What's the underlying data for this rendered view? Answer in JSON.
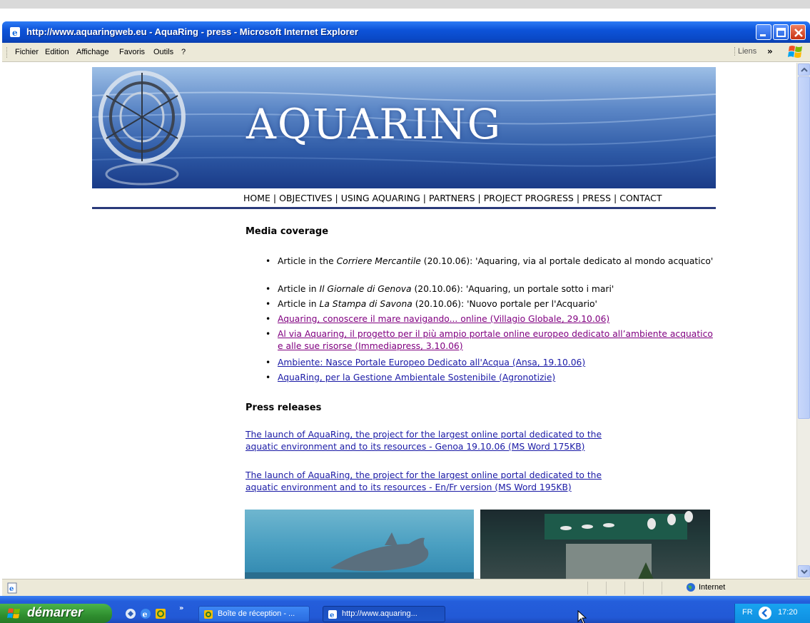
{
  "window": {
    "title": "http://www.aquaringweb.eu - AquaRing - press - Microsoft Internet Explorer"
  },
  "menubar": {
    "items": [
      "Fichier",
      "Edition",
      "Affichage",
      "Favoris",
      "Outils",
      "?"
    ],
    "links_label": "Liens"
  },
  "site": {
    "banner_title": "AQUARING",
    "nav": [
      "HOME",
      "OBJECTIVES",
      "USING AQUARING",
      "PARTNERS",
      "PROJECT PROGRESS",
      "PRESS",
      "CONTACT"
    ],
    "media_heading": "Media coverage",
    "media": [
      {
        "pre": "Article in the ",
        "italic": "Corriere Mercantile",
        "post": " (20.10.06): 'Aquaring, via al portale dedicato al mondo acquatico'",
        "link": false
      },
      {
        "pre": "Article in ",
        "italic": "Il Giornale di Genova",
        "post": " (20.10.06): 'Aquaring, un portale sotto i mari'",
        "link": false
      },
      {
        "pre": "Article in ",
        "italic": "La Stampa di Savona",
        "post": " (20.10.06): 'Nuovo portale per l'Acquario'",
        "link": false
      },
      {
        "text": "Aquaring, conoscere il mare navigando... online (Villagio Globale, 29.10.06)",
        "link": true,
        "visited": true
      },
      {
        "text": "Al via Aquaring, il progetto per il più ampio portale online europeo dedicato all’ambiente acquatico e alle sue risorse (Immediapress, 3.10.06)",
        "link": true,
        "visited": true
      },
      {
        "text": "Ambiente: Nasce Portale Europeo Dedicato all'Acqua (Ansa, 19.10.06)",
        "link": true,
        "visited": false
      },
      {
        "text": "AquaRing, per la Gestione Ambientale Sostenibile (Agronotizie)",
        "link": true,
        "visited": false
      }
    ],
    "press_heading": "Press releases",
    "press": [
      {
        "line1": "The launch of AquaRing, the project for the largest online portal dedicated to the",
        "line2": "aquatic environment and to its resources - Genoa 19.10.06 (MS Word 175KB)"
      },
      {
        "line1": "The launch of AquaRing, the project for the largest online portal dedicated to the",
        "line2": "aquatic environment and to its resources - En/Fr version (MS Word 195KB)"
      }
    ]
  },
  "statusbar": {
    "zone": "Internet"
  },
  "taskbar": {
    "start_label": "démarrer",
    "tasks": [
      {
        "label": "Boîte de réception - ..."
      },
      {
        "label": "http://www.aquaring..."
      }
    ],
    "lang": "FR",
    "time": "17:20"
  },
  "colors": {
    "xp_blue": "#0d53d9",
    "link": "#1a1aa6",
    "visited": "#800080",
    "nav_rule": "#2a3a7a"
  }
}
